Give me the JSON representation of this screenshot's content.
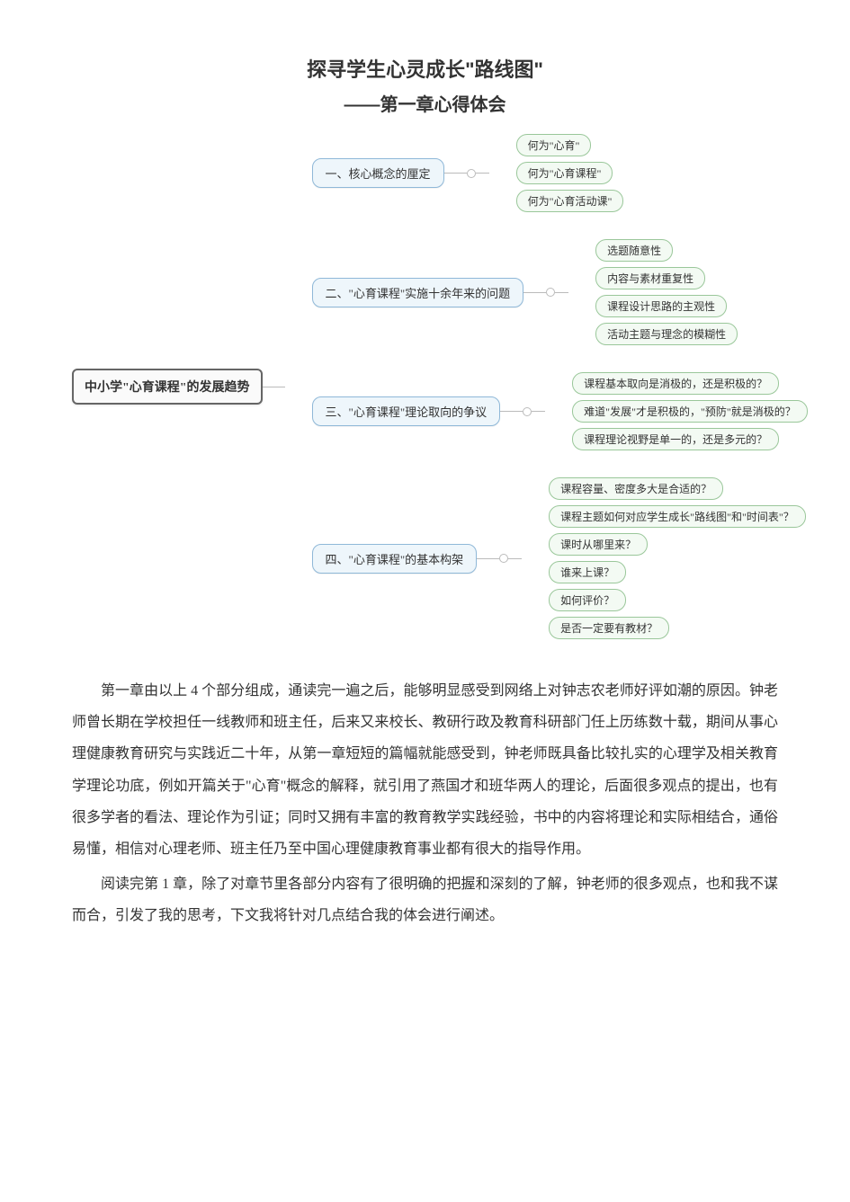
{
  "title": {
    "main": "探寻学生心灵成长\"路线图\"",
    "sub": "——第一章心得体会"
  },
  "mindmap": {
    "root": "中小学\"心育课程\"的发展趋势",
    "branches": [
      {
        "label": "一、核心概念的厘定",
        "children": [
          "何为\"心育\"",
          "何为\"心育课程\"",
          "何为\"心育活动课\""
        ]
      },
      {
        "label": "二、\"心育课程\"实施十余年来的问题",
        "children": [
          "选题随意性",
          "内容与素材重复性",
          "课程设计思路的主观性",
          "活动主题与理念的模糊性"
        ]
      },
      {
        "label": "三、\"心育课程\"理论取向的争议",
        "children": [
          "课程基本取向是消极的，还是积极的？",
          "难道\"发展\"才是积极的，\"预防\"就是消极的？",
          "课程理论视野是单一的，还是多元的？"
        ]
      },
      {
        "label": "四、\"心育课程\"的基本构架",
        "children": [
          "课程容量、密度多大是合适的？",
          "课程主题如何对应学生成长\"路线图\"和\"时间表\"？",
          "课时从哪里来？",
          "谁来上课？",
          "如何评价？",
          "是否一定要有教材？"
        ]
      }
    ]
  },
  "paragraphs": {
    "p1": "第一章由以上 4 个部分组成，通读完一遍之后，能够明显感受到网络上对钟志农老师好评如潮的原因。钟老师曾长期在学校担任一线教师和班主任，后来又来校长、教研行政及教育科研部门任上历练数十载，期间从事心理健康教育研究与实践近二十年，从第一章短短的篇幅就能感受到，钟老师既具备比较扎实的心理学及相关教育学理论功底，例如开篇关于\"心育\"概念的解释，就引用了燕国才和班华两人的理论，后面很多观点的提出，也有很多学者的看法、理论作为引证；同时又拥有丰富的教育教学实践经验，书中的内容将理论和实际相结合，通俗易懂，相信对心理老师、班主任乃至中国心理健康教育事业都有很大的指导作用。",
    "p2": "阅读完第 1 章，除了对章节里各部分内容有了很明确的把握和深刻的了解，钟老师的很多观点，也和我不谋而合，引发了我的思考，下文我将针对几点结合我的体会进行阐述。"
  }
}
